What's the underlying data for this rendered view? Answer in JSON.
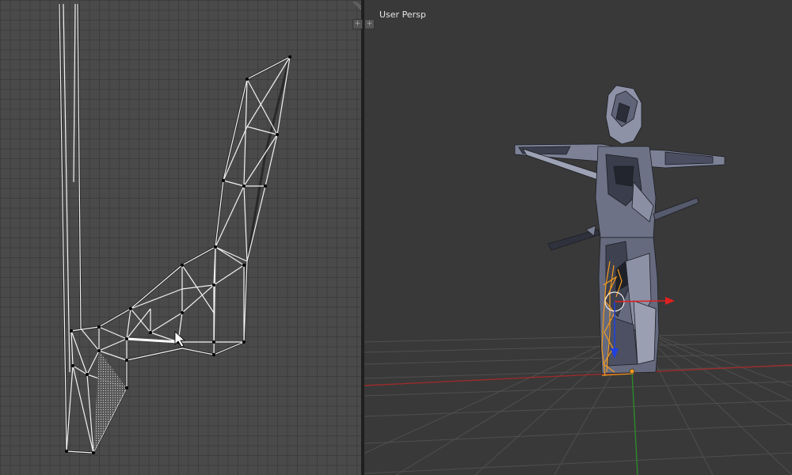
{
  "viewport3d": {
    "view_label": "User Persp",
    "grid_color": "#4f4f4f",
    "x_axis_color": "#9b2b2b",
    "y_axis_color": "#2b8b2b",
    "selection_color": "#f39a1f",
    "gizmo_x_color": "#e02020",
    "gizmo_z_color": "#2040e0"
  },
  "uv_editor": {
    "background": "#4a4a4a",
    "edge_color": "#f0f0f0"
  },
  "icons": {
    "corner_left": "split-area-icon",
    "corner_right": "split-area-icon"
  }
}
